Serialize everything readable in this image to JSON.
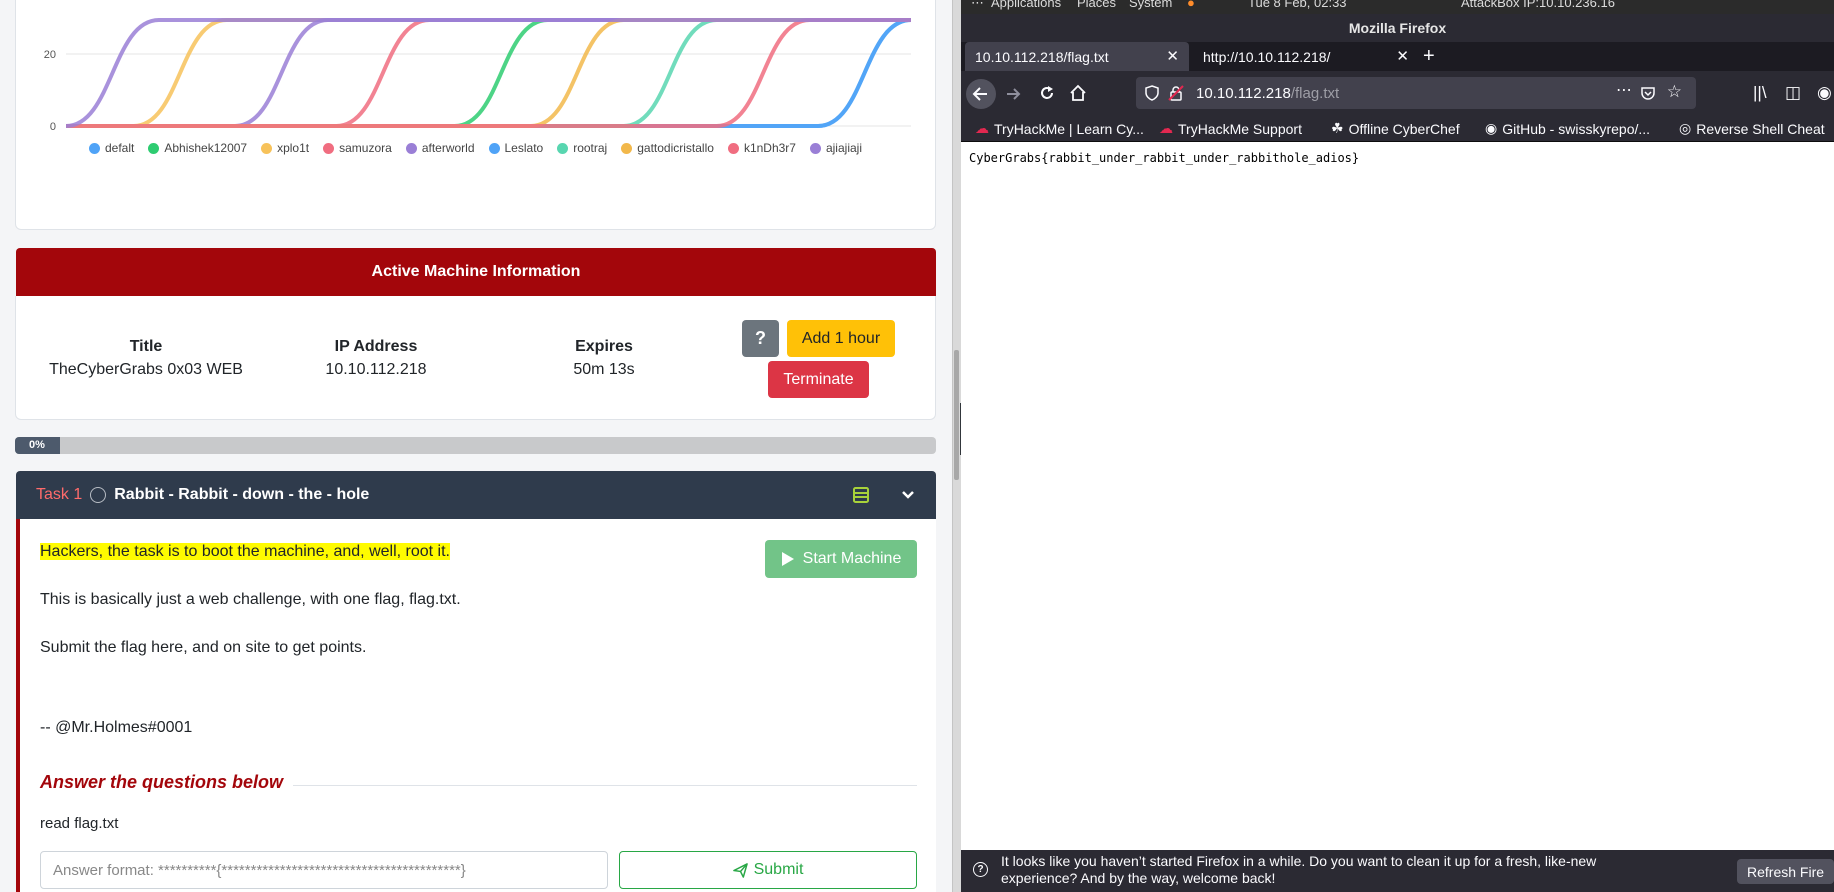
{
  "chart_data": {
    "type": "line",
    "yticks": [
      "20",
      "0"
    ],
    "series": [
      {
        "name": "defalt",
        "color": "#4fa3f7",
        "rise_x": [
          0.89
        ]
      },
      {
        "name": "Abhishek12007",
        "color": "#2ecc71",
        "rise_x": [
          0.46
        ]
      },
      {
        "name": "xplo1t",
        "color": "#f7c25a",
        "rise_x": [
          0.08
        ]
      },
      {
        "name": "samuzora",
        "color": "#f06d80",
        "rise_x": [
          0.32
        ]
      },
      {
        "name": "afterworld",
        "color": "#9a7fd6",
        "rise_x": [
          0.2
        ]
      },
      {
        "name": "Leslato",
        "color": "#4fa3f7",
        "rise_x": [
          0.89
        ]
      },
      {
        "name": "rootraj",
        "color": "#58d6b0",
        "rise_x": [
          0.66
        ]
      },
      {
        "name": "gattodicristallo",
        "color": "#f2b84b",
        "rise_x": [
          0.55
        ]
      },
      {
        "name": "k1nDh3r7",
        "color": "#f06d80",
        "rise_x": [
          0.77
        ]
      },
      {
        "name": "ajiajiaji",
        "color": "#9a7fd6",
        "rise_x": [
          0.0
        ]
      }
    ]
  },
  "active_machine": {
    "header": "Active Machine Information",
    "title_label": "Title",
    "title_value": "TheCyberGrabs 0x03 WEB",
    "ip_label": "IP Address",
    "ip_value": "10.10.112.218",
    "expires_label": "Expires",
    "expires_value": "50m 13s",
    "help_label": "?",
    "add_hour_label": "Add 1 hour",
    "terminate_label": "Terminate"
  },
  "progress": {
    "label": "0%",
    "fraction": 0.0
  },
  "task": {
    "number": "Task 1",
    "title": "Rabbit - Rabbit - down - the - hole",
    "highlight_text": "Hackers, the task is to boot the machine, and, well, root it.",
    "line2": "This is basically just a web challenge, with one flag, flag.txt.",
    "line3": "Submit the flag here, and on site to get points.",
    "signature": "-- @Mr.Holmes#0001",
    "start_label": "Start Machine",
    "answer_heading": "Answer the questions below",
    "question": "read flag.txt",
    "answer_placeholder": "Answer format: **********{*****************************************}",
    "submit_label": "Submit"
  },
  "system_bar": {
    "applications": "Applications",
    "places": "Places",
    "system": "System",
    "datetime": "Tue 8 Feb, 02:33",
    "attackbox": "AttackBox IP:10.10.236.16"
  },
  "firefox": {
    "window_title": "Mozilla Firefox",
    "tabs": [
      {
        "label": "10.10.112.218/flag.txt"
      },
      {
        "label": "http://10.10.112.218/"
      }
    ],
    "url_host": "10.10.112.218",
    "url_path": "/flag.txt",
    "bookmarks": [
      {
        "label": "TryHackMe | Learn Cy..."
      },
      {
        "label": "TryHackMe Support"
      },
      {
        "label": "Offline CyberChef"
      },
      {
        "label": "GitHub - swisskyrepo/..."
      },
      {
        "label": "Reverse Shell Cheat"
      }
    ],
    "page_text": "CyberGrabs{rabbit_under_rabbit_under_rabbithole_adios}",
    "notification": "It looks like you haven’t started Firefox in a while. Do you want to clean it up for a fresh, like-new experience? And by the way, welcome back!",
    "refresh_label": "Refresh Fire"
  }
}
